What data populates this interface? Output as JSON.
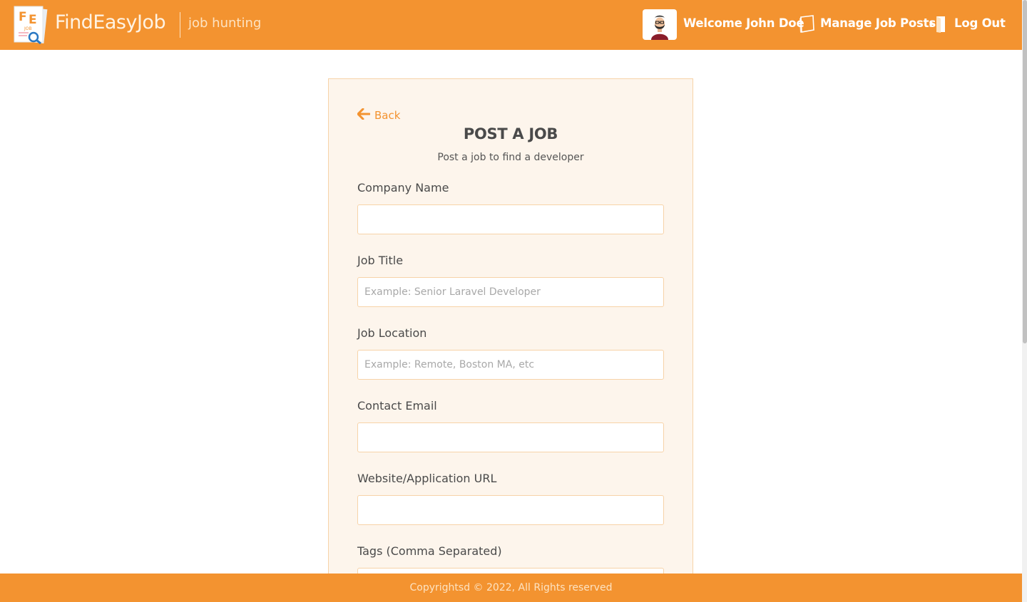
{
  "header": {
    "logo_letters": "FE",
    "logo_small": "JOB",
    "brand": "FindEasyJob",
    "tagline": "job hunting",
    "welcome": "Welcome John Doe",
    "manage_posts": "Manage Job Posts",
    "logout": "Log Out",
    "accent_color": "#f39330"
  },
  "form": {
    "back_label": "Back",
    "title": "POST A JOB",
    "subtitle": "Post a job to find a developer",
    "fields": {
      "company": {
        "label": "Company Name",
        "value": "",
        "placeholder": ""
      },
      "title": {
        "label": "Job Title",
        "value": "",
        "placeholder": "Example: Senior Laravel Developer"
      },
      "location": {
        "label": "Job Location",
        "value": "",
        "placeholder": "Example: Remote, Boston MA, etc"
      },
      "email": {
        "label": "Contact Email",
        "value": "",
        "placeholder": ""
      },
      "website": {
        "label": "Website/Application URL",
        "value": "",
        "placeholder": ""
      },
      "tags": {
        "label": "Tags (Comma Separated)",
        "value": "",
        "placeholder": ""
      }
    }
  },
  "footer": {
    "text": "Copyrightsd © 2022, All Rights reserved"
  }
}
